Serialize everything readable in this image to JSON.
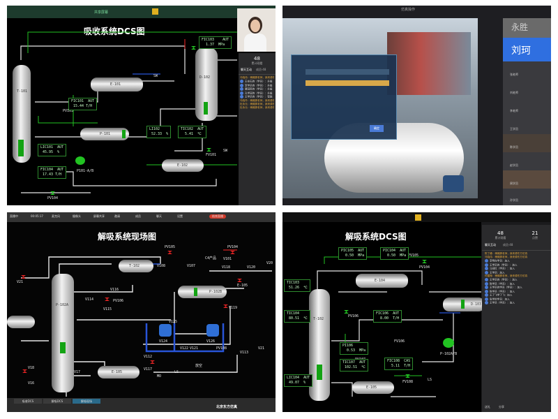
{
  "p1": {
    "window_title": "共享屏幕",
    "title": "吸收系统DCS图",
    "tags": [
      "T-101",
      "PV103",
      "D-102",
      "E-101",
      "P-101",
      "PV101",
      "E-102",
      "P101-A/B",
      "PV104",
      "PV102",
      "FV101",
      "SW",
      "SW"
    ],
    "boxes": {
      "fic103": "FIC103    AUT\n  1.37  MPa",
      "fic101": "FIC101  AUT\n 15.44 T/H",
      "lic101": "LIC101  AUT\n 45.95  %",
      "fic104": "FIC104  AUT\n 17.43 T/H",
      "li102": "LI102\n 52.33  %",
      "tic102": "TIC102  AUT\n  5.41  ℃"
    },
    "chat": {
      "stats": [
        {
          "num": "48",
          "label": "累计观看"
        }
      ],
      "tabs": [
        "聊天互动",
        "成员·48"
      ],
      "lines": [
        {
          "sys": true,
          "text": "马晓伟：稍微那老师，我来源东方仿真"
        },
        {
          "sys": false,
          "text": "王安石的（学员）：升级"
        },
        {
          "sys": false,
          "text": "李学员的（学员）：升级"
        },
        {
          "sys": false,
          "text": "康冠思的（学员）：升级"
        },
        {
          "sys": false,
          "text": "孔学冠的（学员）：升级"
        },
        {
          "sys": false,
          "text": "王学员的（学员）：智能"
        },
        {
          "sys": true,
          "text": "马晓丹：稍微那老师，我来源东方仿真"
        },
        {
          "sys": true,
          "text": "杜永元：稍微那老师，我来源东方仿真"
        },
        {
          "sys": true,
          "text": "杜永元：稍微那老师，我来源东方仿真"
        }
      ]
    }
  },
  "p2": {
    "window_title": "仿真操作",
    "names": [
      "永胜",
      "刘珂",
      "张老师",
      "刘老师",
      "李老师",
      "王学员",
      "陈学员",
      "赵学员",
      "周学员",
      "孙学员"
    ],
    "dialog_button": "确定"
  },
  "p3": {
    "toolbar": [
      "直播中",
      "00:05:17",
      "麦克风",
      "摄像头",
      "屏幕共享",
      "邀请",
      "成员",
      "聊天",
      "设置",
      "结束直播"
    ],
    "title": "解吸系统现场图",
    "tags": [
      "PV105",
      "PV104",
      "PV106",
      "V104",
      "V108",
      "V107",
      "V101",
      "V118",
      "V120",
      "V115",
      "V116",
      "V114",
      "V119",
      "E-104",
      "D-103",
      "T-102",
      "P-102B",
      "P-102A",
      "V124",
      "V126",
      "V117",
      "V125",
      "V121",
      "V122",
      "PV108",
      "V113",
      "V112",
      "V18",
      "V16",
      "V17",
      "LS",
      "MO",
      "放空",
      "C4产品",
      "V20",
      "V21",
      "E-105"
    ],
    "footer_brand": "北京东方仿真",
    "bottom_tabs": [
      "吸收DCS",
      "解吸DCS",
      "解吸现场"
    ]
  },
  "p4": {
    "title": "解吸系统DCS图",
    "boxes": {
      "pic105": "PIC105  AUT\n  0.50  MPa",
      "pic104": "PIC104  AUT\n  0.50  MPa",
      "tic103": "TIC103\n 51.26  ℃",
      "tic104": "TIC104\n 80.51  ℃",
      "fic106": "FIC106  AUT\n  8.00  T/H",
      "pi106": "PI106\n  0.53  MPa",
      "tic107": "TIC107  AUT\n 102.51  ℃",
      "fic108": "FIC108  CAS\n  5.11  T/H",
      "lic104": "LIC104  AUT\n 49.07  %"
    },
    "tags": [
      "PV105",
      "PV104",
      "E-104",
      "D-103",
      "T-102",
      "P-102A/B",
      "E-105",
      "PV106",
      "LS",
      "FV106",
      "FV108",
      "PV107"
    ],
    "chat": {
      "stats": [
        {
          "num": "48",
          "label": "累计观看"
        },
        {
          "num": "21",
          "label": "点赞"
        }
      ],
      "tabs": [
        "聊天互动",
        "成员·48"
      ],
      "lines": [
        {
          "sys": true,
          "text": "陈丁峰：稍微那老师，我来源东方仿真"
        },
        {
          "sys": true,
          "text": "马晓伟：稍微那老师，我来源东方仿真"
        },
        {
          "sys": false,
          "text": "李明在学员：加入"
        },
        {
          "sys": false,
          "text": "王学员的（学员）：加入"
        },
        {
          "sys": false,
          "text": "马冠红（学员）：加入"
        },
        {
          "sys": false,
          "text": "王学员：加入"
        },
        {
          "sys": true,
          "text": "何建辉：稍微那老师，我来源东方仿真"
        },
        {
          "sys": false,
          "text": "王学员的（学员）：加入"
        },
        {
          "sys": false,
          "text": "陈学员（学员）：加入"
        },
        {
          "sys": false,
          "text": "王学员的学员（学员）：加入"
        },
        {
          "sys": false,
          "text": "陈学员（学员）：加入"
        },
        {
          "sys": false,
          "text": "王了飞学了飞：加入"
        },
        {
          "sys": false,
          "text": "张学的学员：加入"
        },
        {
          "sys": false,
          "text": "王学员（学员）：加入"
        }
      ],
      "footer": [
        "送礼",
        "分享"
      ]
    }
  },
  "colors": {
    "pipe": "#e8e8e8",
    "green": "#22c322",
    "red": "#d22222",
    "blue": "#2855d8",
    "panel": "#2a2a2c"
  }
}
